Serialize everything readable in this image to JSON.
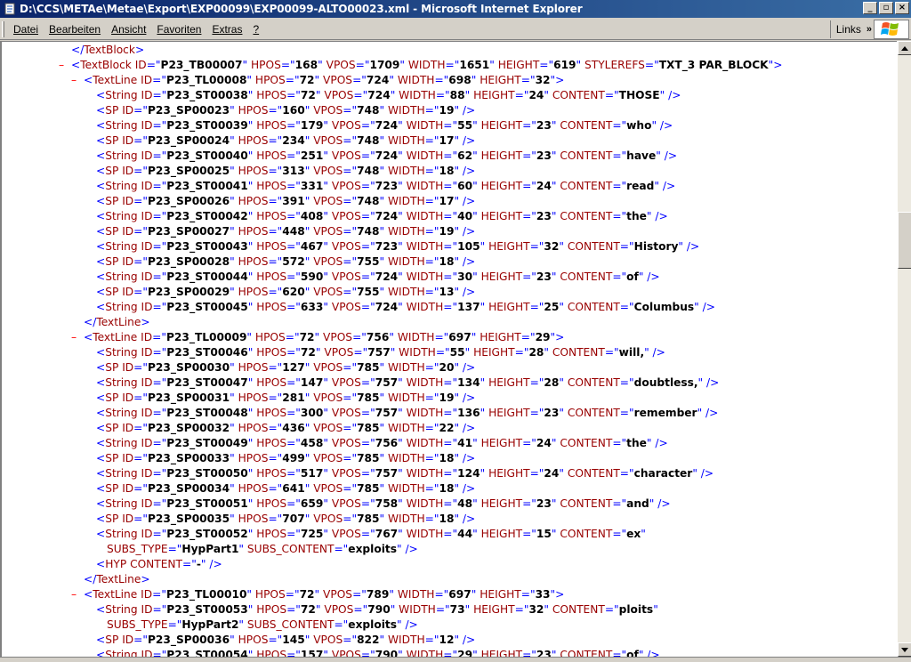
{
  "window": {
    "title": "D:\\CCS\\METAe\\Metae\\Export\\EXP00099\\EXP00099-ALTO00023.xml - Microsoft Internet Explorer",
    "minimize_label": "_",
    "maximize_label": "▫",
    "close_label": "×"
  },
  "menu": {
    "items": [
      "Datei",
      "Bearbeiten",
      "Ansicht",
      "Favoriten",
      "Extras",
      "?"
    ],
    "links_label": "Links",
    "links_chevron": "»"
  },
  "icons": {
    "app": "ie-document-icon",
    "brand": "windows-flag-icon"
  },
  "colors": {
    "titlebar_start": "#0a246a",
    "titlebar_end": "#3a6ea5",
    "tag": "#990000",
    "bracket": "#0000ff",
    "collapse_minus": "#ff0000"
  },
  "xml": {
    "lines": [
      {
        "kind": "close",
        "indent": 1,
        "tag": "TextBlock"
      },
      {
        "kind": "open",
        "indent": 2,
        "minus": true,
        "tag": "TextBlock",
        "attrs": [
          [
            "ID",
            "P23_TB00007"
          ],
          [
            "HPOS",
            "168"
          ],
          [
            "VPOS",
            "1709"
          ],
          [
            "WIDTH",
            "1651"
          ],
          [
            "HEIGHT",
            "619"
          ],
          [
            "STYLEREFS",
            "TXT_3 PAR_BLOCK"
          ]
        ]
      },
      {
        "kind": "open",
        "indent": 3,
        "minus": true,
        "tag": "TextLine",
        "attrs": [
          [
            "ID",
            "P23_TL00008"
          ],
          [
            "HPOS",
            "72"
          ],
          [
            "VPOS",
            "724"
          ],
          [
            "WIDTH",
            "698"
          ],
          [
            "HEIGHT",
            "32"
          ]
        ]
      },
      {
        "kind": "empty",
        "indent": 5,
        "tag": "String",
        "attrs": [
          [
            "ID",
            "P23_ST00038"
          ],
          [
            "HPOS",
            "72"
          ],
          [
            "VPOS",
            "724"
          ],
          [
            "WIDTH",
            "88"
          ],
          [
            "HEIGHT",
            "24"
          ],
          [
            "CONTENT",
            "THOSE"
          ]
        ]
      },
      {
        "kind": "empty",
        "indent": 5,
        "tag": "SP",
        "attrs": [
          [
            "ID",
            "P23_SP00023"
          ],
          [
            "HPOS",
            "160"
          ],
          [
            "VPOS",
            "748"
          ],
          [
            "WIDTH",
            "19"
          ]
        ]
      },
      {
        "kind": "empty",
        "indent": 5,
        "tag": "String",
        "attrs": [
          [
            "ID",
            "P23_ST00039"
          ],
          [
            "HPOS",
            "179"
          ],
          [
            "VPOS",
            "724"
          ],
          [
            "WIDTH",
            "55"
          ],
          [
            "HEIGHT",
            "23"
          ],
          [
            "CONTENT",
            "who"
          ]
        ]
      },
      {
        "kind": "empty",
        "indent": 5,
        "tag": "SP",
        "attrs": [
          [
            "ID",
            "P23_SP00024"
          ],
          [
            "HPOS",
            "234"
          ],
          [
            "VPOS",
            "748"
          ],
          [
            "WIDTH",
            "17"
          ]
        ]
      },
      {
        "kind": "empty",
        "indent": 5,
        "tag": "String",
        "attrs": [
          [
            "ID",
            "P23_ST00040"
          ],
          [
            "HPOS",
            "251"
          ],
          [
            "VPOS",
            "724"
          ],
          [
            "WIDTH",
            "62"
          ],
          [
            "HEIGHT",
            "23"
          ],
          [
            "CONTENT",
            "have"
          ]
        ]
      },
      {
        "kind": "empty",
        "indent": 5,
        "tag": "SP",
        "attrs": [
          [
            "ID",
            "P23_SP00025"
          ],
          [
            "HPOS",
            "313"
          ],
          [
            "VPOS",
            "748"
          ],
          [
            "WIDTH",
            "18"
          ]
        ]
      },
      {
        "kind": "empty",
        "indent": 5,
        "tag": "String",
        "attrs": [
          [
            "ID",
            "P23_ST00041"
          ],
          [
            "HPOS",
            "331"
          ],
          [
            "VPOS",
            "723"
          ],
          [
            "WIDTH",
            "60"
          ],
          [
            "HEIGHT",
            "24"
          ],
          [
            "CONTENT",
            "read"
          ]
        ]
      },
      {
        "kind": "empty",
        "indent": 5,
        "tag": "SP",
        "attrs": [
          [
            "ID",
            "P23_SP00026"
          ],
          [
            "HPOS",
            "391"
          ],
          [
            "VPOS",
            "748"
          ],
          [
            "WIDTH",
            "17"
          ]
        ]
      },
      {
        "kind": "empty",
        "indent": 5,
        "tag": "String",
        "attrs": [
          [
            "ID",
            "P23_ST00042"
          ],
          [
            "HPOS",
            "408"
          ],
          [
            "VPOS",
            "724"
          ],
          [
            "WIDTH",
            "40"
          ],
          [
            "HEIGHT",
            "23"
          ],
          [
            "CONTENT",
            "the"
          ]
        ]
      },
      {
        "kind": "empty",
        "indent": 5,
        "tag": "SP",
        "attrs": [
          [
            "ID",
            "P23_SP00027"
          ],
          [
            "HPOS",
            "448"
          ],
          [
            "VPOS",
            "748"
          ],
          [
            "WIDTH",
            "19"
          ]
        ]
      },
      {
        "kind": "empty",
        "indent": 5,
        "tag": "String",
        "attrs": [
          [
            "ID",
            "P23_ST00043"
          ],
          [
            "HPOS",
            "467"
          ],
          [
            "VPOS",
            "723"
          ],
          [
            "WIDTH",
            "105"
          ],
          [
            "HEIGHT",
            "32"
          ],
          [
            "CONTENT",
            "History"
          ]
        ]
      },
      {
        "kind": "empty",
        "indent": 5,
        "tag": "SP",
        "attrs": [
          [
            "ID",
            "P23_SP00028"
          ],
          [
            "HPOS",
            "572"
          ],
          [
            "VPOS",
            "755"
          ],
          [
            "WIDTH",
            "18"
          ]
        ]
      },
      {
        "kind": "empty",
        "indent": 5,
        "tag": "String",
        "attrs": [
          [
            "ID",
            "P23_ST00044"
          ],
          [
            "HPOS",
            "590"
          ],
          [
            "VPOS",
            "724"
          ],
          [
            "WIDTH",
            "30"
          ],
          [
            "HEIGHT",
            "23"
          ],
          [
            "CONTENT",
            "of"
          ]
        ]
      },
      {
        "kind": "empty",
        "indent": 5,
        "tag": "SP",
        "attrs": [
          [
            "ID",
            "P23_SP00029"
          ],
          [
            "HPOS",
            "620"
          ],
          [
            "VPOS",
            "755"
          ],
          [
            "WIDTH",
            "13"
          ]
        ]
      },
      {
        "kind": "empty",
        "indent": 5,
        "tag": "String",
        "attrs": [
          [
            "ID",
            "P23_ST00045"
          ],
          [
            "HPOS",
            "633"
          ],
          [
            "VPOS",
            "724"
          ],
          [
            "WIDTH",
            "137"
          ],
          [
            "HEIGHT",
            "25"
          ],
          [
            "CONTENT",
            "Columbus"
          ]
        ]
      },
      {
        "kind": "close",
        "indent": 4,
        "tag": "TextLine"
      },
      {
        "kind": "open",
        "indent": 3,
        "minus": true,
        "tag": "TextLine",
        "attrs": [
          [
            "ID",
            "P23_TL00009"
          ],
          [
            "HPOS",
            "72"
          ],
          [
            "VPOS",
            "756"
          ],
          [
            "WIDTH",
            "697"
          ],
          [
            "HEIGHT",
            "29"
          ]
        ]
      },
      {
        "kind": "empty",
        "indent": 5,
        "tag": "String",
        "attrs": [
          [
            "ID",
            "P23_ST00046"
          ],
          [
            "HPOS",
            "72"
          ],
          [
            "VPOS",
            "757"
          ],
          [
            "WIDTH",
            "55"
          ],
          [
            "HEIGHT",
            "28"
          ],
          [
            "CONTENT",
            "will,"
          ]
        ]
      },
      {
        "kind": "empty",
        "indent": 5,
        "tag": "SP",
        "attrs": [
          [
            "ID",
            "P23_SP00030"
          ],
          [
            "HPOS",
            "127"
          ],
          [
            "VPOS",
            "785"
          ],
          [
            "WIDTH",
            "20"
          ]
        ]
      },
      {
        "kind": "empty",
        "indent": 5,
        "tag": "String",
        "attrs": [
          [
            "ID",
            "P23_ST00047"
          ],
          [
            "HPOS",
            "147"
          ],
          [
            "VPOS",
            "757"
          ],
          [
            "WIDTH",
            "134"
          ],
          [
            "HEIGHT",
            "28"
          ],
          [
            "CONTENT",
            "doubtless,"
          ]
        ]
      },
      {
        "kind": "empty",
        "indent": 5,
        "tag": "SP",
        "attrs": [
          [
            "ID",
            "P23_SP00031"
          ],
          [
            "HPOS",
            "281"
          ],
          [
            "VPOS",
            "785"
          ],
          [
            "WIDTH",
            "19"
          ]
        ]
      },
      {
        "kind": "empty",
        "indent": 5,
        "tag": "String",
        "attrs": [
          [
            "ID",
            "P23_ST00048"
          ],
          [
            "HPOS",
            "300"
          ],
          [
            "VPOS",
            "757"
          ],
          [
            "WIDTH",
            "136"
          ],
          [
            "HEIGHT",
            "23"
          ],
          [
            "CONTENT",
            "remember"
          ]
        ]
      },
      {
        "kind": "empty",
        "indent": 5,
        "tag": "SP",
        "attrs": [
          [
            "ID",
            "P23_SP00032"
          ],
          [
            "HPOS",
            "436"
          ],
          [
            "VPOS",
            "785"
          ],
          [
            "WIDTH",
            "22"
          ]
        ]
      },
      {
        "kind": "empty",
        "indent": 5,
        "tag": "String",
        "attrs": [
          [
            "ID",
            "P23_ST00049"
          ],
          [
            "HPOS",
            "458"
          ],
          [
            "VPOS",
            "756"
          ],
          [
            "WIDTH",
            "41"
          ],
          [
            "HEIGHT",
            "24"
          ],
          [
            "CONTENT",
            "the"
          ]
        ]
      },
      {
        "kind": "empty",
        "indent": 5,
        "tag": "SP",
        "attrs": [
          [
            "ID",
            "P23_SP00033"
          ],
          [
            "HPOS",
            "499"
          ],
          [
            "VPOS",
            "785"
          ],
          [
            "WIDTH",
            "18"
          ]
        ]
      },
      {
        "kind": "empty",
        "indent": 5,
        "tag": "String",
        "attrs": [
          [
            "ID",
            "P23_ST00050"
          ],
          [
            "HPOS",
            "517"
          ],
          [
            "VPOS",
            "757"
          ],
          [
            "WIDTH",
            "124"
          ],
          [
            "HEIGHT",
            "24"
          ],
          [
            "CONTENT",
            "character"
          ]
        ]
      },
      {
        "kind": "empty",
        "indent": 5,
        "tag": "SP",
        "attrs": [
          [
            "ID",
            "P23_SP00034"
          ],
          [
            "HPOS",
            "641"
          ],
          [
            "VPOS",
            "785"
          ],
          [
            "WIDTH",
            "18"
          ]
        ]
      },
      {
        "kind": "empty",
        "indent": 5,
        "tag": "String",
        "attrs": [
          [
            "ID",
            "P23_ST00051"
          ],
          [
            "HPOS",
            "659"
          ],
          [
            "VPOS",
            "758"
          ],
          [
            "WIDTH",
            "48"
          ],
          [
            "HEIGHT",
            "23"
          ],
          [
            "CONTENT",
            "and"
          ]
        ]
      },
      {
        "kind": "empty",
        "indent": 5,
        "tag": "SP",
        "attrs": [
          [
            "ID",
            "P23_SP00035"
          ],
          [
            "HPOS",
            "707"
          ],
          [
            "VPOS",
            "785"
          ],
          [
            "WIDTH",
            "18"
          ]
        ]
      },
      {
        "kind": "partial",
        "indent": 5,
        "tag": "String",
        "attrs": [
          [
            "ID",
            "P23_ST00052"
          ],
          [
            "HPOS",
            "725"
          ],
          [
            "VPOS",
            "767"
          ],
          [
            "WIDTH",
            "44"
          ],
          [
            "HEIGHT",
            "15"
          ],
          [
            "CONTENT",
            "ex"
          ]
        ]
      },
      {
        "kind": "cont",
        "indent": 6,
        "attrs": [
          [
            "SUBS_TYPE",
            "HypPart1"
          ],
          [
            "SUBS_CONTENT",
            "exploits"
          ]
        ]
      },
      {
        "kind": "empty",
        "indent": 5,
        "tag": "HYP",
        "attrs": [
          [
            "CONTENT",
            "-"
          ]
        ]
      },
      {
        "kind": "close",
        "indent": 4,
        "tag": "TextLine"
      },
      {
        "kind": "open",
        "indent": 3,
        "minus": true,
        "tag": "TextLine",
        "attrs": [
          [
            "ID",
            "P23_TL00010"
          ],
          [
            "HPOS",
            "72"
          ],
          [
            "VPOS",
            "789"
          ],
          [
            "WIDTH",
            "697"
          ],
          [
            "HEIGHT",
            "33"
          ]
        ]
      },
      {
        "kind": "partial",
        "indent": 5,
        "tag": "String",
        "attrs": [
          [
            "ID",
            "P23_ST00053"
          ],
          [
            "HPOS",
            "72"
          ],
          [
            "VPOS",
            "790"
          ],
          [
            "WIDTH",
            "73"
          ],
          [
            "HEIGHT",
            "32"
          ],
          [
            "CONTENT",
            "ploits"
          ]
        ]
      },
      {
        "kind": "cont",
        "indent": 6,
        "attrs": [
          [
            "SUBS_TYPE",
            "HypPart2"
          ],
          [
            "SUBS_CONTENT",
            "exploits"
          ]
        ]
      },
      {
        "kind": "empty",
        "indent": 5,
        "tag": "SP",
        "attrs": [
          [
            "ID",
            "P23_SP00036"
          ],
          [
            "HPOS",
            "145"
          ],
          [
            "VPOS",
            "822"
          ],
          [
            "WIDTH",
            "12"
          ]
        ]
      },
      {
        "kind": "empty",
        "indent": 5,
        "tag": "String",
        "attrs": [
          [
            "ID",
            "P23_ST00054"
          ],
          [
            "HPOS",
            "157"
          ],
          [
            "VPOS",
            "790"
          ],
          [
            "WIDTH",
            "29"
          ],
          [
            "HEIGHT",
            "23"
          ],
          [
            "CONTENT",
            "of"
          ]
        ]
      }
    ]
  }
}
